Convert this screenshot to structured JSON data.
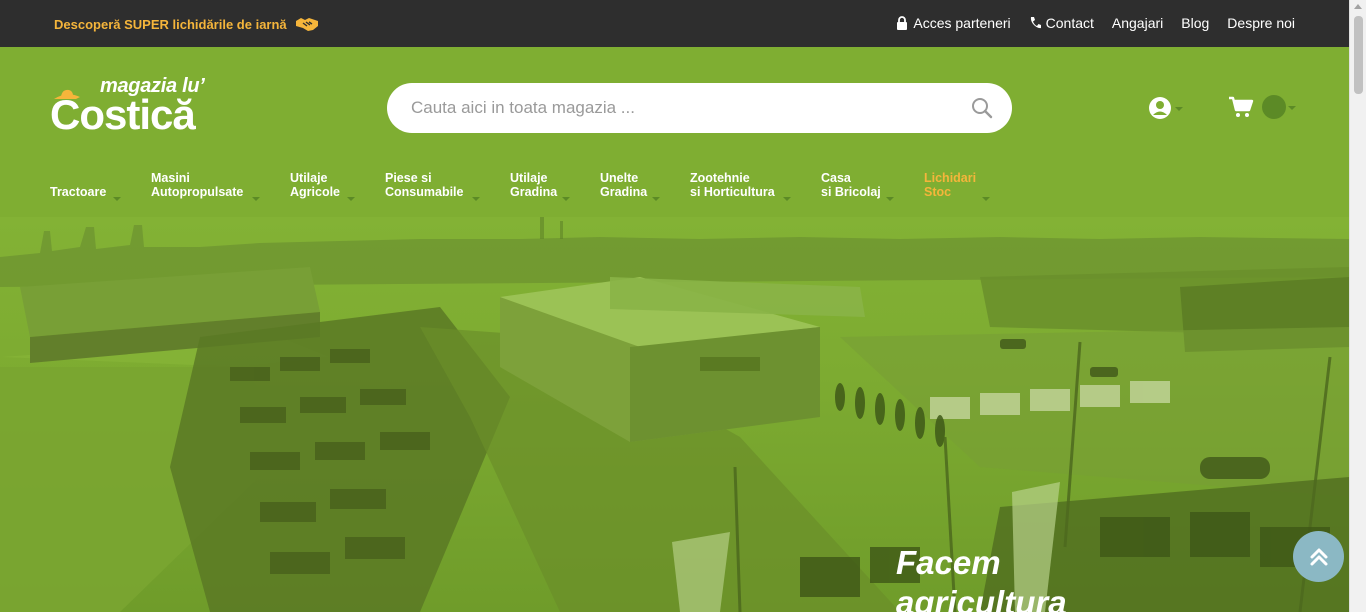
{
  "topbar": {
    "promo_text": "Descoperă SUPER lichidările de iarnă",
    "promo_icon": "handshake-icon",
    "links": [
      {
        "label": "Acces parteneri",
        "icon": "lock-icon"
      },
      {
        "label": "Contact",
        "icon": "phone-icon"
      },
      {
        "label": "Angajari"
      },
      {
        "label": "Blog"
      },
      {
        "label": "Despre noi"
      }
    ]
  },
  "logo": {
    "line1": "magazia lu’",
    "line2": "Costică"
  },
  "search": {
    "placeholder": "Cauta aici in toata magazia ..."
  },
  "nav": {
    "items": [
      {
        "label": "Tractoare"
      },
      {
        "label": "Masini\nAutopropulsate"
      },
      {
        "label": "Utilaje\nAgricole"
      },
      {
        "label": "Piese si\nConsumabile"
      },
      {
        "label": "Utilaje\nGradina"
      },
      {
        "label": "Unelte\nGradina"
      },
      {
        "label": "Zootehnie\nsi Horticultura"
      },
      {
        "label": "Casa\nsi Bricolaj"
      },
      {
        "label": "Lichidari\nStoc"
      }
    ]
  },
  "hero": {
    "title": "Facem\nagricultura"
  },
  "colors": {
    "topbar_bg": "#2e2e2e",
    "brand_green": "#7fae32",
    "accent_orange": "#f5b53b",
    "dark_green": "#5c8a26"
  }
}
